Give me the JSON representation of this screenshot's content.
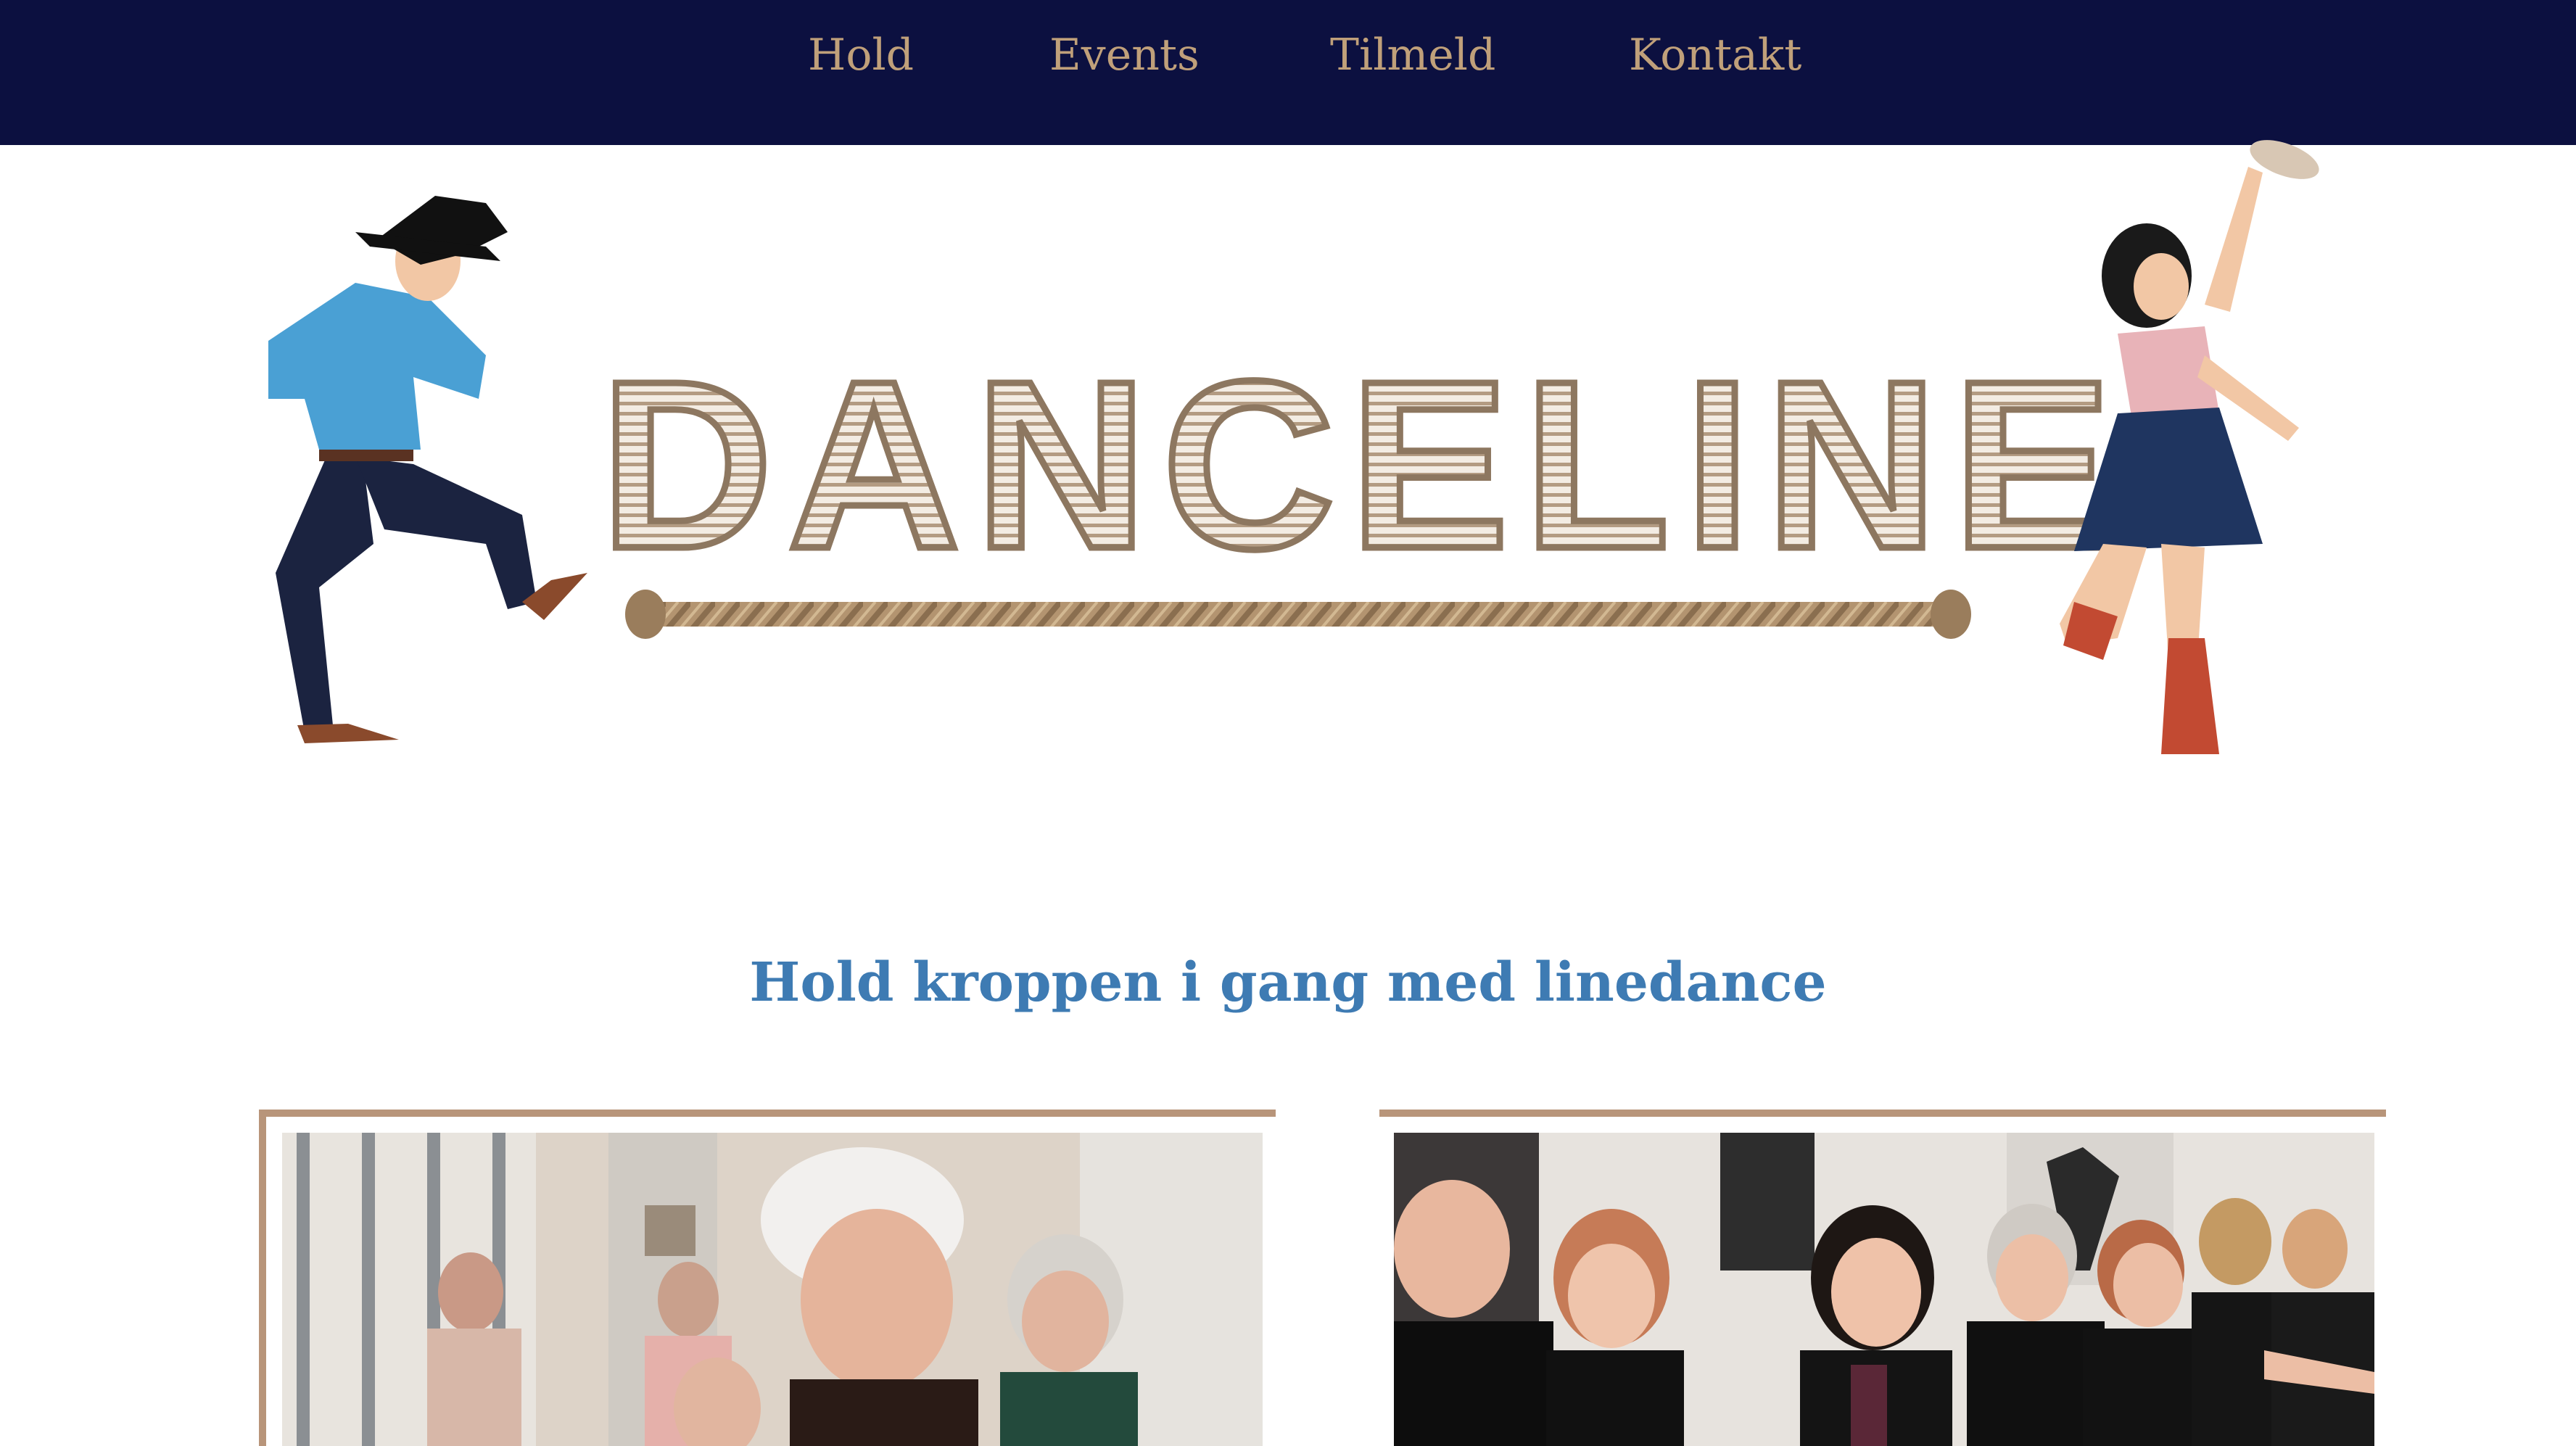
{
  "nav": {
    "items": [
      {
        "label": "Hold"
      },
      {
        "label": "Events"
      },
      {
        "label": "Tilmeld"
      },
      {
        "label": "Kontakt"
      }
    ]
  },
  "hero": {
    "logo_text": "DANCELINE"
  },
  "tagline": "Hold kroppen i gang med linedance",
  "colors": {
    "nav_bg": "#0c1040",
    "nav_text": "#c0a07a",
    "tagline": "#3e7bb3",
    "card_border": "#b8957a"
  },
  "cards": [
    {
      "image": "seniors-dancing-photo"
    },
    {
      "image": "linedance-group-photo"
    }
  ]
}
